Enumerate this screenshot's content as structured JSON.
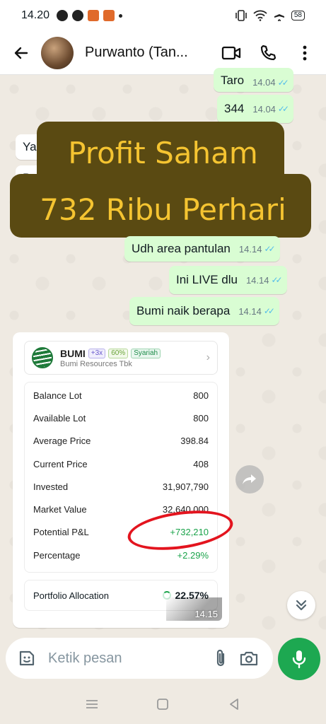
{
  "status_bar": {
    "time": "14.20",
    "battery": "58"
  },
  "header": {
    "contact_name": "Purwanto (Tan..."
  },
  "messages": [
    {
      "direction": "out",
      "text": "Taro",
      "time": "14.04"
    },
    {
      "direction": "out",
      "text": "344",
      "time": "14.04"
    },
    {
      "direction": "in",
      "text": "Ya",
      "time": ""
    },
    {
      "direction": "in",
      "text": "Bu",
      "time": ""
    },
    {
      "direction": "out",
      "text": "Udh area pantulan",
      "time": "14.14"
    },
    {
      "direction": "out",
      "text": "Ini LIVE dlu",
      "time": "14.14"
    },
    {
      "direction": "out",
      "text": "Bumi naik berapa",
      "time": "14.14"
    }
  ],
  "overlay": {
    "line1": "Profit Saham",
    "line2": "732 Ribu Perhari"
  },
  "stock_card": {
    "ticker": "BUMI",
    "leverage_tag": "+3x",
    "percent_tag": "60%",
    "sharia_tag": "Syariah",
    "company": "Bumi Resources Tbk",
    "rows": [
      {
        "label": "Balance Lot",
        "value": "800"
      },
      {
        "label": "Available Lot",
        "value": "800"
      },
      {
        "label": "Average Price",
        "value": "398.84"
      },
      {
        "label": "Current Price",
        "value": "408"
      },
      {
        "label": "Invested",
        "value": "31,907,790"
      },
      {
        "label": "Market Value",
        "value": "32,640,000"
      },
      {
        "label": "Potential P&L",
        "value": "+732,210"
      },
      {
        "label": "Percentage",
        "value": "+2.29%"
      }
    ],
    "allocation_label": "Portfolio Allocation",
    "allocation_value": "22.57%",
    "image_time": "14.15"
  },
  "composer": {
    "placeholder": "Ketik pesan"
  },
  "colors": {
    "accent_green": "#1da851",
    "bubble_out": "#d9fdd3",
    "banner_bg": "#5a4a12",
    "banner_text": "#f5c431",
    "pnl_positive": "#1aa34a",
    "annotation_red": "#e3141e"
  }
}
